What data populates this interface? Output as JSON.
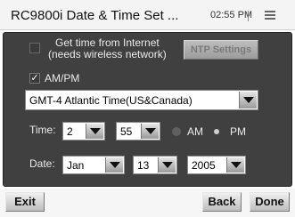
{
  "title_bar": {
    "title": "RC9800i Date & Time Set ...",
    "time": "02:55 PM",
    "menu_icon": "hamburger-icon"
  },
  "internet_time": {
    "checked": false,
    "label_line1": "Get time from Internet",
    "label_line2": "(needs wireless network)",
    "ntp_button": "NTP Settings",
    "ntp_enabled": false
  },
  "ampm": {
    "checked": true,
    "check_mark": "✓",
    "label": "AM/PM"
  },
  "timezone": {
    "value": "GMT-4 Atlantic Time(US&Canada)"
  },
  "time": {
    "label": "Time:",
    "hour": "2",
    "minute": "55",
    "am_label": "AM",
    "pm_label": "PM",
    "selected": "PM"
  },
  "date": {
    "label": "Date:",
    "month": "Jan",
    "day": "13",
    "year": "2005"
  },
  "toolbar": {
    "exit": "Exit",
    "back": "Back",
    "done": "Done"
  },
  "colors": {
    "panel": "#404040",
    "title_bar": "#f4f4f4"
  }
}
